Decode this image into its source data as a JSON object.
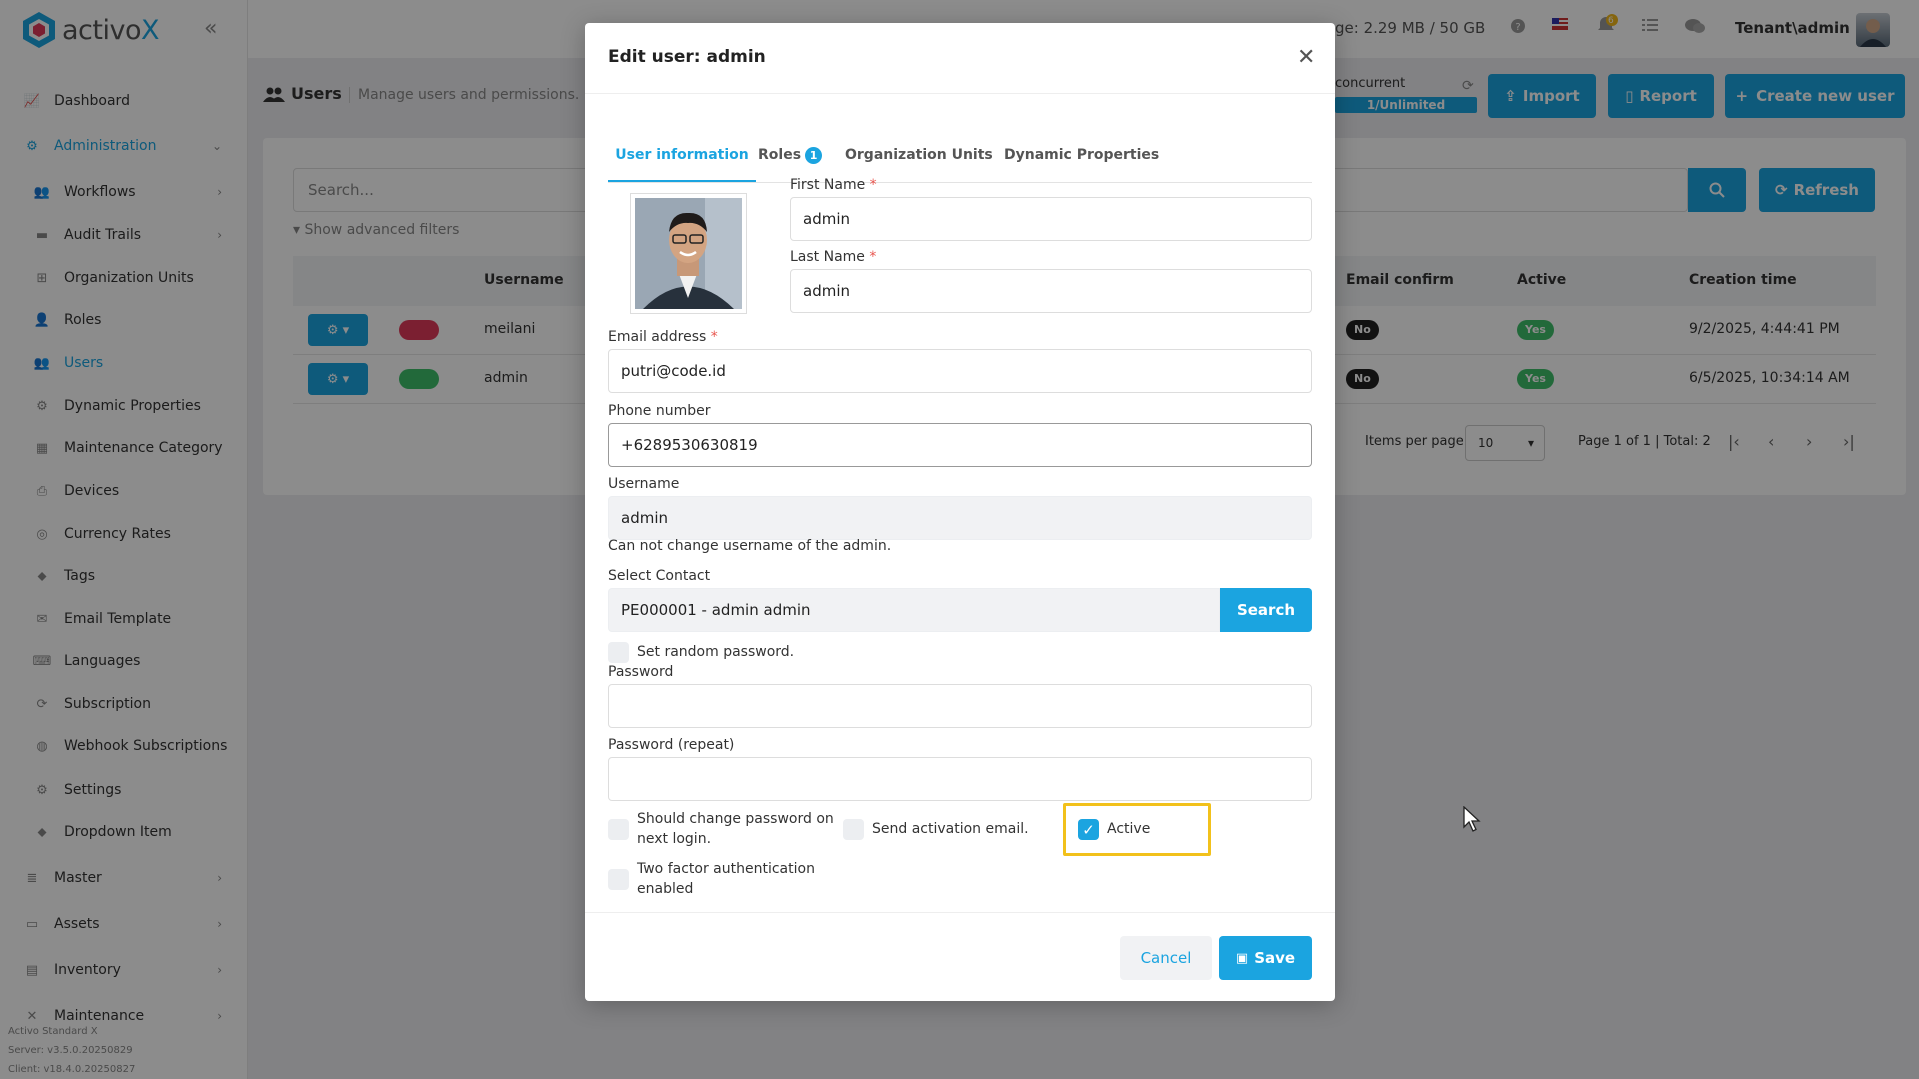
{
  "app": {
    "brand_a": "activo",
    "brand_b": "X"
  },
  "sidebar": {
    "items": [
      {
        "label": "Dashboard",
        "icon": "chart-icon",
        "level": "top"
      },
      {
        "label": "Administration",
        "icon": "cogs-icon",
        "level": "top",
        "active": true
      },
      {
        "label": "Workflows",
        "icon": "users-icon",
        "level": "sub"
      },
      {
        "label": "Audit Trails",
        "icon": "folder-icon",
        "level": "sub"
      },
      {
        "label": "Organization Units",
        "icon": "sitemap-icon",
        "level": "sub"
      },
      {
        "label": "Roles",
        "icon": "user-icon",
        "level": "sub"
      },
      {
        "label": "Users",
        "icon": "users-icon",
        "level": "sub",
        "active": true
      },
      {
        "label": "Dynamic Properties",
        "icon": "gear-icon",
        "level": "sub"
      },
      {
        "label": "Maintenance Category",
        "icon": "grid-icon",
        "level": "sub"
      },
      {
        "label": "Devices",
        "icon": "printer-icon",
        "level": "sub"
      },
      {
        "label": "Currency Rates",
        "icon": "coins-icon",
        "level": "sub"
      },
      {
        "label": "Tags",
        "icon": "tags-icon",
        "level": "sub"
      },
      {
        "label": "Email Template",
        "icon": "envelope-icon",
        "level": "sub"
      },
      {
        "label": "Languages",
        "icon": "language-icon",
        "level": "sub"
      },
      {
        "label": "Subscription",
        "icon": "refresh-icon",
        "level": "sub"
      },
      {
        "label": "Webhook Subscriptions",
        "icon": "globe-icon",
        "level": "sub"
      },
      {
        "label": "Settings",
        "icon": "gear-icon",
        "level": "sub"
      },
      {
        "label": "Dropdown Item",
        "icon": "tags-icon",
        "level": "sub"
      },
      {
        "label": "Master",
        "icon": "database-icon",
        "level": "top"
      },
      {
        "label": "Assets",
        "icon": "laptop-icon",
        "level": "top"
      },
      {
        "label": "Inventory",
        "icon": "inbox-icon",
        "level": "top"
      },
      {
        "label": "Maintenance",
        "icon": "tools-icon",
        "level": "top"
      }
    ],
    "version": [
      "Activo Standard X",
      "Server: v3.5.0.20250829",
      "Client: v18.4.0.20250827"
    ]
  },
  "topbar": {
    "usage": "ge: 2.29 MB / 50 GB",
    "notification_count": "6",
    "tenant": "Tenant\\admin"
  },
  "page": {
    "title": "Users",
    "subtitle": "Manage users and permissions.",
    "concurrent_label": "concurrent",
    "concurrent_value": "1/Unlimited",
    "import_label": "Import",
    "report_label": "Report",
    "create_label": "Create new user",
    "search_placeholder": "Search...",
    "refresh_label": "Refresh",
    "advanced_filters": "Show advanced filters",
    "columns": {
      "username": "Username",
      "email_confirm": "Email confirm",
      "active": "Active",
      "creation_time": "Creation time"
    },
    "rows": [
      {
        "username": "meilani",
        "email_confirm": "No",
        "active": "Yes",
        "creation_time": "9/2/2025, 4:44:41 PM",
        "color": "#e0395a"
      },
      {
        "username": "admin",
        "email_confirm": "No",
        "active": "Yes",
        "creation_time": "6/5/2025, 10:34:14 AM",
        "color": "#3fbf6b"
      }
    ],
    "items_per_page_label": "Items per page",
    "items_per_page": "10",
    "page_info": "Page 1 of 1 | Total: 2"
  },
  "modal": {
    "title": "Edit user: admin",
    "tabs": [
      {
        "label": "User information",
        "active": true
      },
      {
        "label": "Roles",
        "badge": "1"
      },
      {
        "label": "Organization Units"
      },
      {
        "label": "Dynamic Properties"
      }
    ],
    "first_name_label": "First Name",
    "first_name": "admin",
    "last_name_label": "Last Name",
    "last_name": "admin",
    "email_label": "Email address",
    "email": "putri@code.id",
    "phone_label": "Phone number",
    "phone": "+6289530630819",
    "username_label": "Username",
    "username": "admin",
    "username_help": "Can not change username of the admin.",
    "contact_label": "Select Contact",
    "contact": "PE000001 - admin admin",
    "contact_search": "Search",
    "random_password_label": "Set random password.",
    "password_label": "Password",
    "password_repeat_label": "Password (repeat)",
    "change_password_label": "Should change password on next login.",
    "send_activation_label": "Send activation email.",
    "active_label": "Active",
    "two_factor_label": "Two factor authentication enabled",
    "cancel_label": "Cancel",
    "save_label": "Save",
    "accent": "#1ba4e0",
    "highlight": "#f2c11b"
  }
}
